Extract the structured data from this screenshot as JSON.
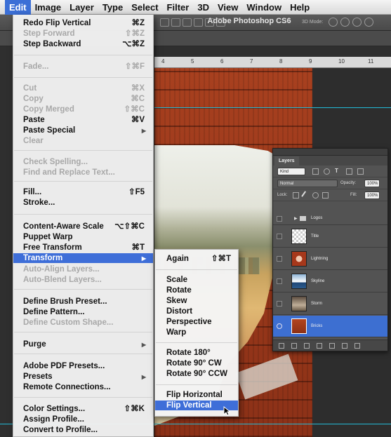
{
  "menubar": {
    "items": [
      "Edit",
      "Image",
      "Layer",
      "Type",
      "Select",
      "Filter",
      "3D",
      "View",
      "Window",
      "Help"
    ],
    "active": "Edit"
  },
  "app_title": "Adobe Photoshop CS6",
  "ruler_ticks": [
    "4",
    "5",
    "6",
    "7",
    "8",
    "9",
    "10",
    "11"
  ],
  "edit_menu": {
    "items": [
      {
        "label": "Redo Flip Vertical",
        "shortcut": "⌘Z",
        "disabled": false
      },
      {
        "label": "Step Forward",
        "shortcut": "⇧⌘Z",
        "disabled": true
      },
      {
        "label": "Step Backward",
        "shortcut": "⌥⌘Z",
        "disabled": false
      },
      {
        "label": "Fade...",
        "shortcut": "⇧⌘F",
        "disabled": true
      },
      {
        "label": "Cut",
        "shortcut": "⌘X",
        "disabled": true
      },
      {
        "label": "Copy",
        "shortcut": "⌘C",
        "disabled": true
      },
      {
        "label": "Copy Merged",
        "shortcut": "⇧⌘C",
        "disabled": true
      },
      {
        "label": "Paste",
        "shortcut": "⌘V",
        "disabled": false
      },
      {
        "label": "Paste Special",
        "shortcut": "",
        "disabled": false,
        "submenu": true
      },
      {
        "label": "Clear",
        "shortcut": "",
        "disabled": true
      },
      {
        "label": "Check Spelling...",
        "shortcut": "",
        "disabled": true
      },
      {
        "label": "Find and Replace Text...",
        "shortcut": "",
        "disabled": true
      },
      {
        "label": "Fill...",
        "shortcut": "⇧F5",
        "disabled": false
      },
      {
        "label": "Stroke...",
        "shortcut": "",
        "disabled": false
      },
      {
        "label": "Content-Aware Scale",
        "shortcut": "⌥⇧⌘C",
        "disabled": false
      },
      {
        "label": "Puppet Warp",
        "shortcut": "",
        "disabled": false
      },
      {
        "label": "Free Transform",
        "shortcut": "⌘T",
        "disabled": false
      },
      {
        "label": "Transform",
        "shortcut": "",
        "disabled": false,
        "submenu": true,
        "highlighted": true
      },
      {
        "label": "Auto-Align Layers...",
        "shortcut": "",
        "disabled": true
      },
      {
        "label": "Auto-Blend Layers...",
        "shortcut": "",
        "disabled": true
      },
      {
        "label": "Define Brush Preset...",
        "shortcut": "",
        "disabled": false
      },
      {
        "label": "Define Pattern...",
        "shortcut": "",
        "disabled": false
      },
      {
        "label": "Define Custom Shape...",
        "shortcut": "",
        "disabled": true
      },
      {
        "label": "Purge",
        "shortcut": "",
        "disabled": false,
        "submenu": true
      },
      {
        "label": "Adobe PDF Presets...",
        "shortcut": "",
        "disabled": false
      },
      {
        "label": "Presets",
        "shortcut": "",
        "disabled": false,
        "submenu": true
      },
      {
        "label": "Remote Connections...",
        "shortcut": "",
        "disabled": false
      },
      {
        "label": "Color Settings...",
        "shortcut": "⇧⌘K",
        "disabled": false
      },
      {
        "label": "Assign Profile...",
        "shortcut": "",
        "disabled": false
      },
      {
        "label": "Convert to Profile...",
        "shortcut": "",
        "disabled": false
      }
    ]
  },
  "transform_submenu": {
    "items": [
      {
        "label": "Again",
        "shortcut": "⇧⌘T"
      },
      {
        "label": "Scale",
        "shortcut": ""
      },
      {
        "label": "Rotate",
        "shortcut": ""
      },
      {
        "label": "Skew",
        "shortcut": ""
      },
      {
        "label": "Distort",
        "shortcut": ""
      },
      {
        "label": "Perspective",
        "shortcut": ""
      },
      {
        "label": "Warp",
        "shortcut": ""
      },
      {
        "label": "Rotate 180°",
        "shortcut": ""
      },
      {
        "label": "Rotate 90° CW",
        "shortcut": ""
      },
      {
        "label": "Rotate 90° CCW",
        "shortcut": ""
      },
      {
        "label": "Flip Horizontal",
        "shortcut": ""
      },
      {
        "label": "Flip Vertical",
        "shortcut": "",
        "highlighted": true
      }
    ]
  },
  "layers_panel": {
    "tab": "Layers",
    "filter_kind": "Kind",
    "blend_mode": "Normal",
    "opacity_label": "Opacity:",
    "opacity": "100%",
    "lock_label": "Lock:",
    "fill_label": "Fill:",
    "fill": "100%",
    "folder": "Logos",
    "layers": [
      {
        "name": "Title",
        "thumb": "checker"
      },
      {
        "name": "Lightning",
        "thumb": "red-w"
      },
      {
        "name": "Skyline",
        "thumb": "sky"
      },
      {
        "name": "Storm",
        "thumb": "storm"
      },
      {
        "name": "Bricks",
        "thumb": "bricks",
        "selected": true
      }
    ]
  },
  "colors": {
    "menu_highlight": "#3e6ed8",
    "guide": "#23bcd9",
    "brick": "#a8401f"
  }
}
